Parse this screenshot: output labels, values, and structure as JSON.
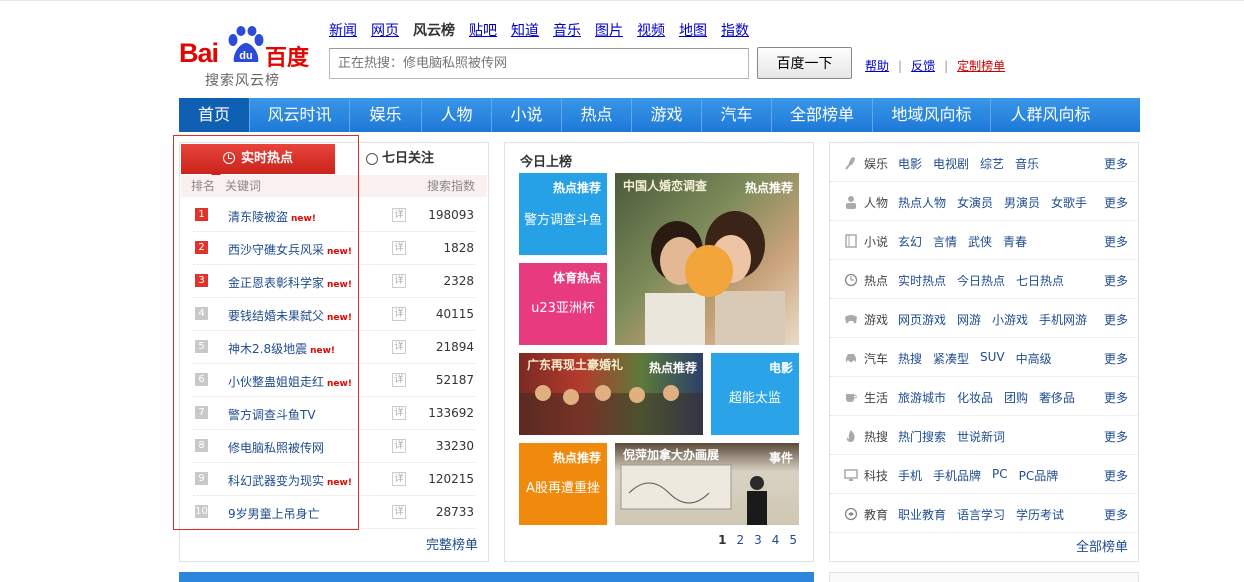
{
  "brand": {
    "logo_bai": "Bai",
    "logo_du": "du",
    "logo_cn": "百度",
    "subtitle": "搜索风云榜",
    "color": "#e10601"
  },
  "topnav": [
    "新闻",
    "网页",
    "风云榜",
    "贴吧",
    "知道",
    "音乐",
    "图片",
    "视频",
    "地图",
    "指数"
  ],
  "search": {
    "placeholder": "正在热搜：修电脑私照被传网",
    "button": "百度一下"
  },
  "header_links": {
    "help": "帮助",
    "feedback": "反馈",
    "custom": "定制榜单",
    "sep": "|"
  },
  "mainnav": [
    "首页",
    "风云时讯",
    "娱乐",
    "人物",
    "小说",
    "热点",
    "游戏",
    "汽车",
    "全部榜单",
    "地域风向标",
    "人群风向标"
  ],
  "left": {
    "tab_hot": "实时热点",
    "tab_week": "七日关注",
    "col_rank": "排名",
    "col_kw": "关键词",
    "col_idx": "搜索指数",
    "detail": "详",
    "new_tag": "new!",
    "rows": [
      {
        "rank": "1",
        "kw": "清东陵被盗",
        "new": true,
        "idx": "198093"
      },
      {
        "rank": "2",
        "kw": "西沙守礁女兵风采",
        "new": true,
        "idx": "1828"
      },
      {
        "rank": "3",
        "kw": "金正恩表彰科学家",
        "new": true,
        "idx": "2328"
      },
      {
        "rank": "4",
        "kw": "要钱结婚未果弑父",
        "new": true,
        "idx": "40115"
      },
      {
        "rank": "5",
        "kw": "神木2.8级地震",
        "new": true,
        "idx": "21894"
      },
      {
        "rank": "6",
        "kw": "小伙整蛊姐姐走红",
        "new": true,
        "idx": "52187"
      },
      {
        "rank": "7",
        "kw": "警方调查斗鱼TV",
        "new": false,
        "idx": "133692"
      },
      {
        "rank": "8",
        "kw": "修电脑私照被传网",
        "new": false,
        "idx": "33230"
      },
      {
        "rank": "9",
        "kw": "科幻武器变为现实",
        "new": true,
        "idx": "120215"
      },
      {
        "rank": "10",
        "kw": "9岁男童上吊身亡",
        "new": false,
        "idx": "28733"
      }
    ],
    "more": "完整榜单"
  },
  "mid": {
    "title": "今日上榜",
    "tiles": {
      "t1": {
        "tag": "热点推荐",
        "title": "警方调查斗鱼"
      },
      "t2": {
        "tag": "热点推荐",
        "caption": "中国人婚恋调查"
      },
      "t3": {
        "tag": "体育热点",
        "title": "u23亚洲杯"
      },
      "t4": {
        "tag": "热点推荐",
        "caption": "广东再现土豪婚礼"
      },
      "t5": {
        "tag": "电影",
        "title": "超能太监"
      },
      "t6": {
        "tag": "热点推荐",
        "title": "A股再遭重挫"
      },
      "t7": {
        "tag": "事件",
        "caption": "倪萍加拿大办画展"
      }
    },
    "pager": [
      "1",
      "2",
      "3",
      "4",
      "5"
    ]
  },
  "right": {
    "more": "更多",
    "cats": [
      {
        "icon": "mic-icon",
        "name": "娱乐",
        "subs": [
          "电影",
          "电视剧",
          "综艺",
          "音乐"
        ]
      },
      {
        "icon": "person-icon",
        "name": "人物",
        "subs": [
          "热点人物",
          "女演员",
          "男演员",
          "女歌手"
        ]
      },
      {
        "icon": "book-icon",
        "name": "小说",
        "subs": [
          "玄幻",
          "言情",
          "武侠",
          "青春"
        ]
      },
      {
        "icon": "clock-icon",
        "name": "热点",
        "subs": [
          "实时热点",
          "今日热点",
          "七日热点"
        ]
      },
      {
        "icon": "gamepad-icon",
        "name": "游戏",
        "subs": [
          "网页游戏",
          "网游",
          "小游戏",
          "手机网游"
        ]
      },
      {
        "icon": "car-icon",
        "name": "汽车",
        "subs": [
          "热搜",
          "紧凑型",
          "SUV",
          "中高级"
        ]
      },
      {
        "icon": "cup-icon",
        "name": "生活",
        "subs": [
          "旅游城市",
          "化妆品",
          "团购",
          "奢侈品"
        ]
      },
      {
        "icon": "flame-icon",
        "name": "热搜",
        "subs": [
          "热门搜索",
          "世说新词"
        ]
      },
      {
        "icon": "monitor-icon",
        "name": "科技",
        "subs": [
          "手机",
          "手机品牌",
          "PC",
          "PC品牌"
        ]
      },
      {
        "icon": "edu-icon",
        "name": "教育",
        "subs": [
          "职业教育",
          "语言学习",
          "学历考试"
        ]
      }
    ],
    "all": "全部榜单"
  }
}
